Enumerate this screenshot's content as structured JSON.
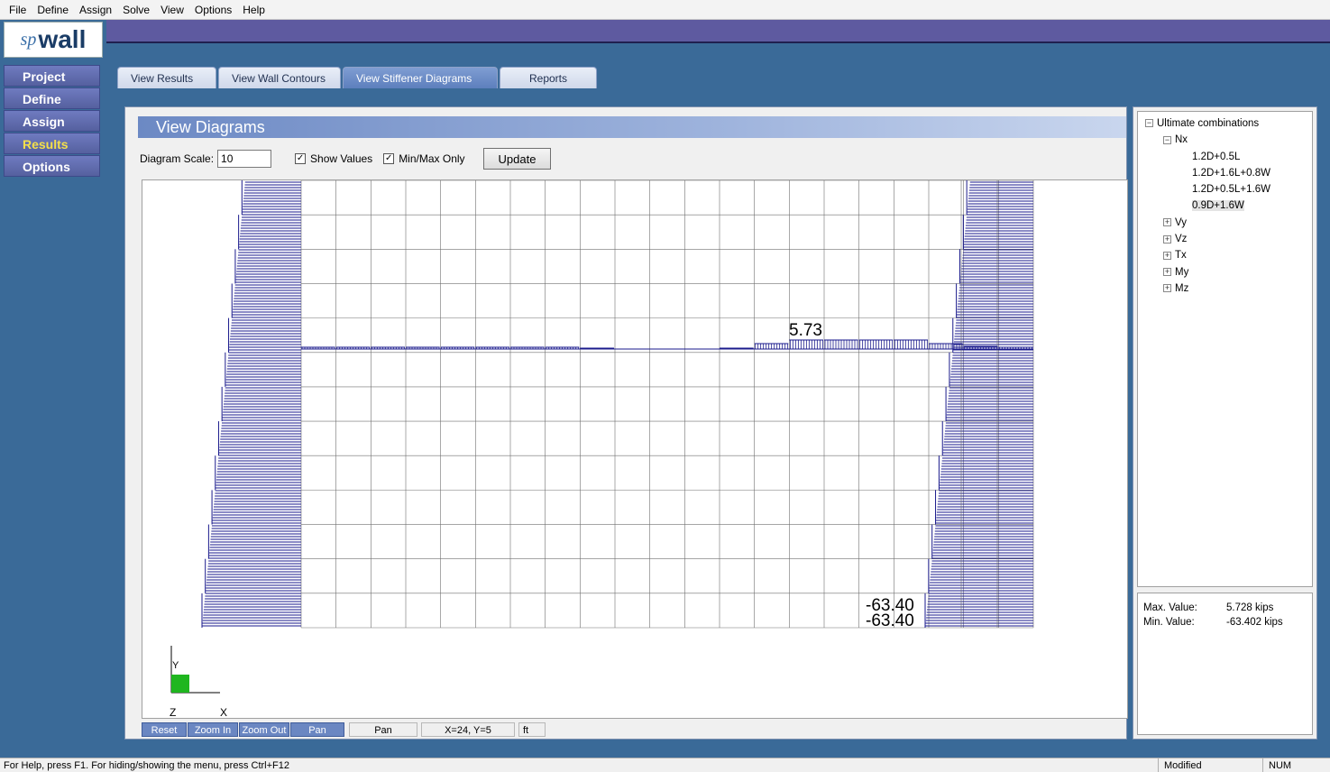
{
  "menu": [
    "File",
    "Define",
    "Assign",
    "Solve",
    "View",
    "Options",
    "Help"
  ],
  "logo": {
    "sp": "sp",
    "wall": "wall"
  },
  "nav": [
    {
      "label": "Project",
      "active": false
    },
    {
      "label": "Define",
      "active": false
    },
    {
      "label": "Assign",
      "active": false
    },
    {
      "label": "Results",
      "active": true
    },
    {
      "label": "Options",
      "active": false
    }
  ],
  "tabs": [
    {
      "label": "View Results",
      "active": false
    },
    {
      "label": "View Wall Contours",
      "active": false
    },
    {
      "label": "View Stiffener Diagrams",
      "active": true
    },
    {
      "label": "Reports",
      "active": false
    }
  ],
  "panel": {
    "title": "View Diagrams",
    "scale_label": "Diagram Scale:",
    "scale_value": "10",
    "show_values_label": "Show Values",
    "show_values_checked": true,
    "minmax_label": "Min/Max Only",
    "minmax_checked": true,
    "update_label": "Update"
  },
  "diagram": {
    "max_label": "5.73",
    "min_label_1": "-63.40",
    "min_label_2": "-63.40",
    "axes": {
      "y": "Y",
      "z": "Z",
      "x": "X"
    },
    "diagram_color": "#1a1a8c",
    "grid_color": "#707070"
  },
  "bottom": {
    "reset": "Reset",
    "zoom_in": "Zoom In",
    "zoom_out": "Zoom Out",
    "pan": "Pan",
    "mode": "Pan",
    "coords": "X=24, Y=5",
    "unit": "ft"
  },
  "tree": {
    "root": "Ultimate combinations",
    "nx": "Nx",
    "combos": [
      "1.2D+0.5L",
      "1.2D+1.6L+0.8W",
      "1.2D+0.5L+1.6W",
      "0.9D+1.6W"
    ],
    "selected_index": 3,
    "others": [
      "Vy",
      "Vz",
      "Tx",
      "My",
      "Mz"
    ]
  },
  "stats": {
    "max_label": "Max. Value:",
    "max_value": "5.728 kips",
    "min_label": "Min. Value:",
    "min_value": "-63.402 kips"
  },
  "statusbar": {
    "help": "For Help, press F1. For hiding/showing the menu, press Ctrl+F12",
    "modified": "Modified",
    "num": "NUM"
  }
}
